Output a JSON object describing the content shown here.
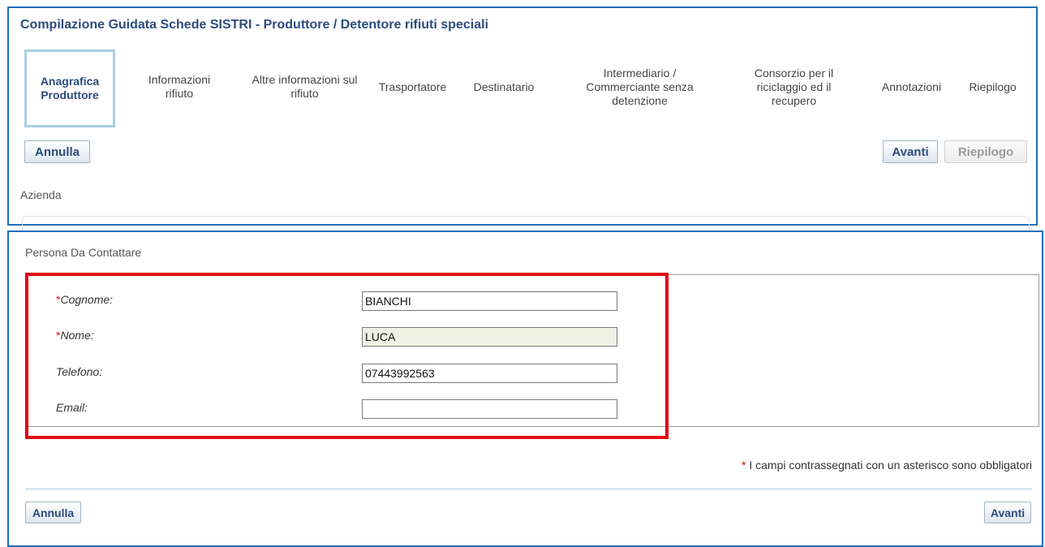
{
  "page_title": "Compilazione Guidata Schede SISTRI - Produttore / Detentore rifiuti speciali",
  "wizard_steps": [
    {
      "label": "Anagrafica Produttore",
      "active": true
    },
    {
      "label": "Informazioni rifiuto"
    },
    {
      "label": "Altre informazioni sul rifiuto"
    },
    {
      "label": "Trasportatore"
    },
    {
      "label": "Destinatario"
    },
    {
      "label": "Intermediario / Commerciante senza detenzione"
    },
    {
      "label": "Consorzio per il riciclaggio ed il recupero"
    },
    {
      "label": "Annotazioni"
    },
    {
      "label": "Riepilogo"
    }
  ],
  "top_toolbar": {
    "cancel_label": "Annulla",
    "next_label": "Avanti",
    "summary_label": "Riepilogo"
  },
  "company_section_label": "Azienda",
  "contact_section_label": "Persona Da Contattare",
  "form": {
    "surname": {
      "label": "Cognome:",
      "value": "BIANCHI",
      "required": true
    },
    "name": {
      "label": "Nome:",
      "value": "LUCA",
      "required": true
    },
    "phone": {
      "label": "Telefono:",
      "value": "07443992563"
    },
    "email": {
      "label": "Email:",
      "value": ""
    }
  },
  "required_marker": "*",
  "mandatory_note": "I campi contrassegnati con un asterisco sono obbligatori",
  "bottom_toolbar": {
    "cancel_label": "Annulla",
    "next_label": "Avanti"
  },
  "colors": {
    "panel_border": "#1f6fba",
    "highlight": "#e30613",
    "title": "#2b4c7a"
  }
}
